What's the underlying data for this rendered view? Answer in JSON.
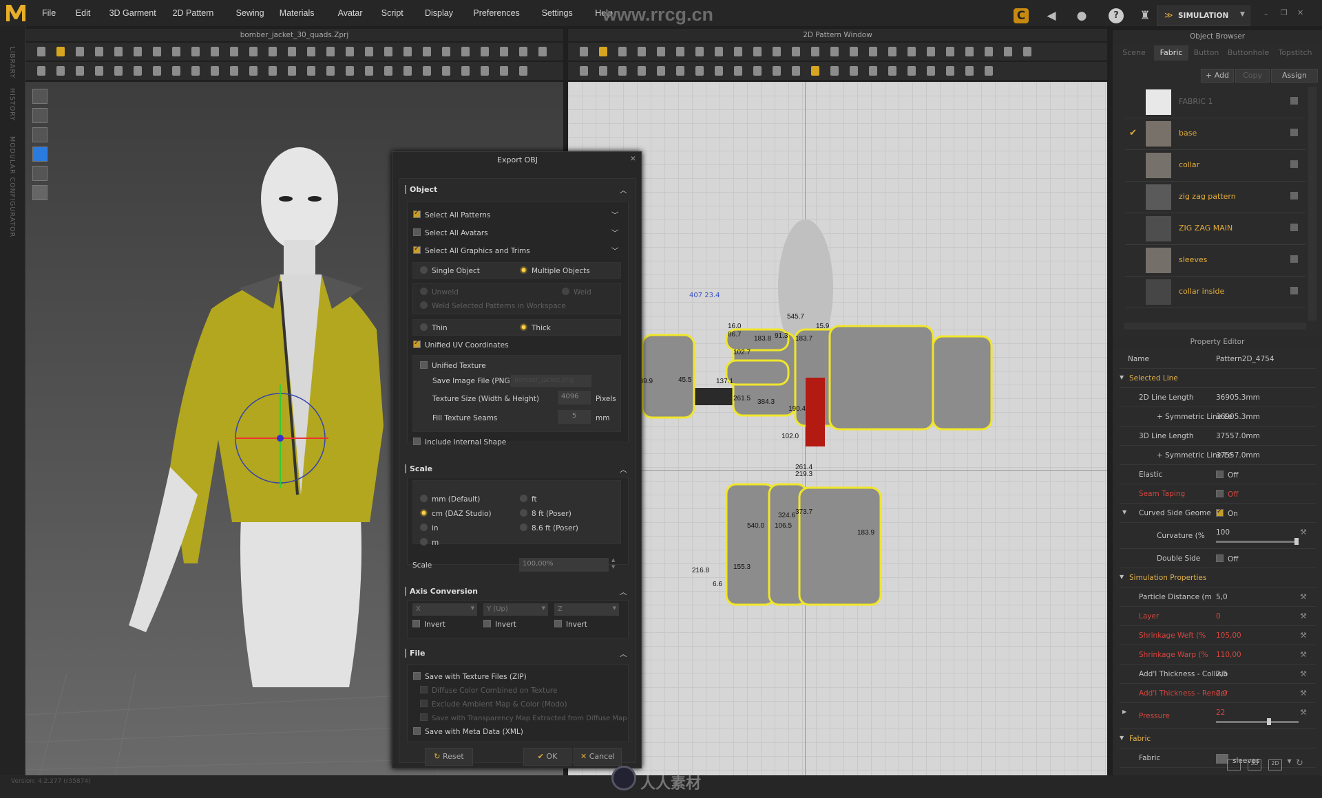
{
  "app": {
    "logo_text": "MD",
    "menu": [
      "File",
      "Edit",
      "3D Garment",
      "2D Pattern",
      "Sewing",
      "Materials",
      "Avatar",
      "Script",
      "Display",
      "Preferences",
      "Settings",
      "Help"
    ],
    "watermark": "www.rrcg.cn",
    "mode": "SIMULATION",
    "accent": "#e2ad3a",
    "error_color": "#d6463e"
  },
  "left_sidebar": [
    "LIBRARY",
    "HISTORY",
    "MODULAR CONFIGURATOR"
  ],
  "window_3d": {
    "title": "bomber_jacket_30_quads.Zprj"
  },
  "window_2d": {
    "title": "2D Pattern Window",
    "coord_label": "407 23.4",
    "measurements": [
      "545.7",
      "16.0",
      "15.9",
      "86.7",
      "183.8",
      "91.3",
      "183.7",
      "102.7",
      "137.1",
      "45.5",
      "189.9",
      "384.3",
      "261.5",
      "190.4",
      "102.0",
      "261.4",
      "219.3",
      "373.7",
      "324.6",
      "540.0",
      "106.5",
      "183.9",
      "216.8",
      "155.3",
      "6.6"
    ]
  },
  "object_browser": {
    "title": "Object Browser",
    "tabs": [
      "Scene",
      "Fabric",
      "Button",
      "Buttonhole",
      "Topstitch"
    ],
    "active_tab": "Fabric",
    "buttons": {
      "add": "+ Add",
      "copy": "Copy",
      "assign": "Assign"
    },
    "fabrics": [
      {
        "name": "FABRIC 1",
        "color": "#e8e8e8",
        "dim": true
      },
      {
        "name": "base",
        "color": "#77716a",
        "checked": true
      },
      {
        "name": "collar",
        "color": "#76716a"
      },
      {
        "name": "zig zag pattern",
        "color": "#5a5a5a"
      },
      {
        "name": "ZIG ZAG MAIN",
        "color": "#4e4e4e"
      },
      {
        "name": "sleeves",
        "color": "#746f68"
      },
      {
        "name": "collar inside",
        "color": "#464646"
      }
    ]
  },
  "property_editor": {
    "title": "Property Editor",
    "rows": [
      {
        "label": "Name",
        "value": "Pattern2D_4754",
        "indent": 0
      },
      {
        "label": "Selected Line",
        "section": true,
        "indent": 0
      },
      {
        "label": "2D Line Length",
        "value": "36905.3mm",
        "indent": 1
      },
      {
        "label": "+ Symmetric Line Le",
        "value": "36905.3mm",
        "indent": 2
      },
      {
        "label": "3D Line Length",
        "value": "37557.0mm",
        "indent": 1
      },
      {
        "label": "+ Symmetric Line Le",
        "value": "37557.0mm",
        "indent": 2
      },
      {
        "label": "Elastic",
        "value": "Off",
        "checkbox": false,
        "indent": 1
      },
      {
        "label": "Seam Taping",
        "value": "Off",
        "checkbox": false,
        "red": true,
        "indent": 1
      },
      {
        "label": "Curved Side Geome",
        "value": "On",
        "checkbox": true,
        "expander": true,
        "indent": 1
      },
      {
        "label": "Curvature (%",
        "value": "100",
        "slider": 1.0,
        "wrench": true,
        "indent": 2
      },
      {
        "label": "Double Side",
        "value": "Off",
        "checkbox": false,
        "indent": 2
      },
      {
        "label": "Simulation Properties",
        "section": true,
        "indent": 0
      },
      {
        "label": "Particle Distance (m",
        "value": "5,0",
        "wrench": true,
        "indent": 1
      },
      {
        "label": "Layer",
        "value": "0",
        "wrench": true,
        "red": true,
        "indent": 1
      },
      {
        "label": "Shrinkage Weft (%",
        "value": "105,00",
        "wrench": true,
        "red": true,
        "indent": 1
      },
      {
        "label": "Shrinkage Warp (%",
        "value": "110,00",
        "wrench": true,
        "red": true,
        "indent": 1
      },
      {
        "label": "Add'l Thickness - Collisio",
        "value": "2,5",
        "wrench": true,
        "indent": 1
      },
      {
        "label": "Add'l Thickness - Render",
        "value": "2,0",
        "wrench": true,
        "red": true,
        "indent": 1
      },
      {
        "label": "Pressure",
        "value": "22",
        "slider": 0.65,
        "wrench": true,
        "red": true,
        "collapsed": true,
        "indent": 1
      },
      {
        "label": "Fabric",
        "section": true,
        "indent": 0
      },
      {
        "label": "Fabric",
        "value": "sleeves",
        "dropdown": true,
        "indent": 1
      }
    ],
    "footer_buttons": [
      "3D",
      "2D"
    ]
  },
  "dialog": {
    "title": "Export OBJ",
    "object": {
      "header": "Object",
      "select_all_patterns": {
        "label": "Select All Patterns",
        "checked": true
      },
      "select_all_avatars": {
        "label": "Select All Avatars",
        "checked": false
      },
      "select_all_graphics": {
        "label": "Select All Graphics and Trims",
        "checked": true
      },
      "single_object": "Single Object",
      "multiple_objects": "Multiple Objects",
      "object_mode": "Multiple Objects",
      "unweld": "Unweld",
      "weld": "Weld",
      "weld_selected": "Weld Selected Patterns in Workspace",
      "thin": "Thin",
      "thick": "Thick",
      "thickness": "Thick",
      "unified_uv": {
        "label": "Unified UV Coordinates",
        "checked": true
      },
      "unified_texture": {
        "label": "Unified Texture",
        "checked": false
      },
      "save_image_label": "Save Image File (PNG)",
      "save_image_value": "bomber_jacket.png",
      "texture_size_label": "Texture Size (Width & Height)",
      "texture_size_value": "4096",
      "texture_size_unit": "Pixels",
      "fill_seams_label": "Fill Texture Seams",
      "fill_seams_value": "5",
      "fill_seams_unit": "mm",
      "include_internal": {
        "label": "Include Internal Shape",
        "checked": false
      }
    },
    "scale": {
      "header": "Scale",
      "units": [
        "mm (Default)",
        "cm (DAZ Studio)",
        "in",
        "m",
        "ft",
        "8 ft (Poser)",
        "8.6 ft (Poser)"
      ],
      "selected": "cm (DAZ Studio)",
      "scale_label": "Scale",
      "scale_value": "100,00%"
    },
    "axis": {
      "header": "Axis Conversion",
      "axes": [
        "X",
        "Y (Up)",
        "Z"
      ],
      "invert_label": "Invert"
    },
    "file": {
      "header": "File",
      "save_zip": {
        "label": "Save with Texture Files (ZIP)",
        "checked": false
      },
      "diffuse": "Diffuse Color Combined on Texture",
      "exclude_ambient": "Exclude Ambient Map & Color (Modo)",
      "transparency": "Save with Transparency Map Extracted from Diffuse Map",
      "meta": {
        "label": "Save with Meta Data (XML)",
        "checked": false
      }
    },
    "buttons": {
      "reset": "Reset",
      "ok": "OK",
      "cancel": "Cancel"
    }
  },
  "status": {
    "version": "Version: 4.2.277 (r35874)",
    "brand": "人人素材"
  }
}
